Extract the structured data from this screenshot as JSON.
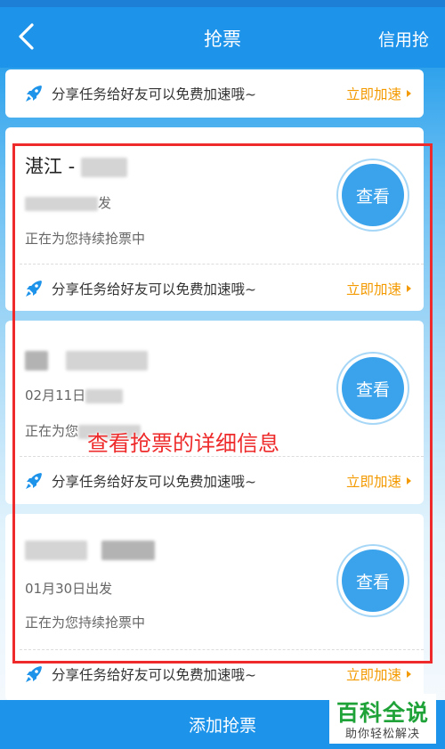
{
  "header": {
    "title": "抢票",
    "right_action": "信用抢"
  },
  "share_banner": {
    "message": "分享任务给好友可以免费加速哦~",
    "action": "立即加速"
  },
  "tickets": [
    {
      "route": "湛江 - ",
      "date": "",
      "date_suffix": "发",
      "status": "正在为您持续抢票中",
      "button": "查看",
      "share_message": "分享任务给好友可以免费加速哦~",
      "share_action": "立即加速"
    },
    {
      "route": "",
      "date": "02月11日",
      "date_suffix": "",
      "status": "正在为您",
      "button": "查看",
      "share_message": "分享任务给好友可以免费加速哦~",
      "share_action": "立即加速"
    },
    {
      "route": "",
      "date": "01月30日出发",
      "date_suffix": "",
      "status": "正在为您持续抢票中",
      "button": "查看",
      "share_message": "分享任务给好友可以免费加速哦~",
      "share_action": "立即加速"
    }
  ],
  "annotation": "查看抢票的详细信息",
  "bottom_button": "添加抢票",
  "watermark": {
    "main": "百科全说",
    "sub": "助你轻松解决"
  },
  "colors": {
    "primary": "#1e93ea",
    "accent_orange": "#f39a00",
    "annotation_red": "#ee2a2a",
    "watermark_green": "#1fa339"
  },
  "icons": {
    "back": "chevron-left-icon",
    "share": "rocket-icon",
    "action_arrow": "triangle-right-icon"
  }
}
